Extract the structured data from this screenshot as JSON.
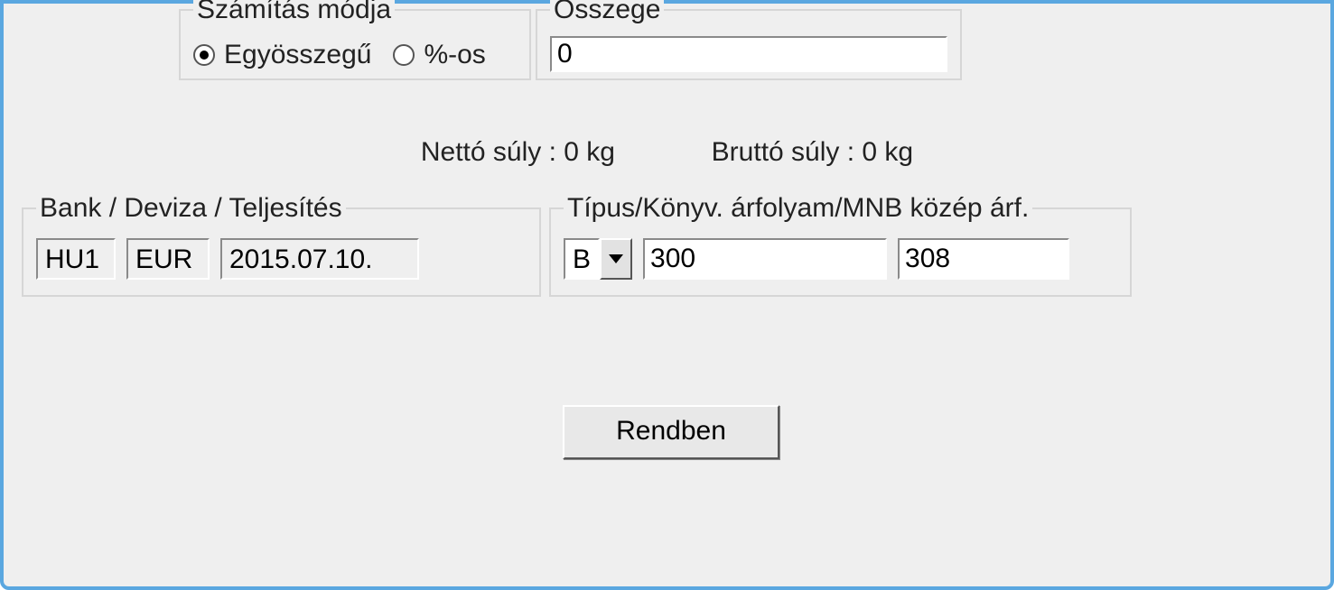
{
  "calc_mode": {
    "legend": "Számítás módja",
    "option_lump": "Egyösszegű",
    "option_percent": "%-os",
    "selected": "lump"
  },
  "amount": {
    "legend": "Összege",
    "value": "0"
  },
  "weights": {
    "net_label": "Nettó súly :  0 kg",
    "gross_label": "Bruttó súly :  0 kg"
  },
  "bank_group": {
    "legend": "Bank / Deviza / Teljesítés",
    "bank": "HU1",
    "currency": "EUR",
    "date": "2015.07.10."
  },
  "rate_group": {
    "legend": "Típus/Könyv. árfolyam/MNB közép árf.",
    "type": "B",
    "rate1": "300",
    "rate2": "308"
  },
  "buttons": {
    "ok": "Rendben"
  }
}
